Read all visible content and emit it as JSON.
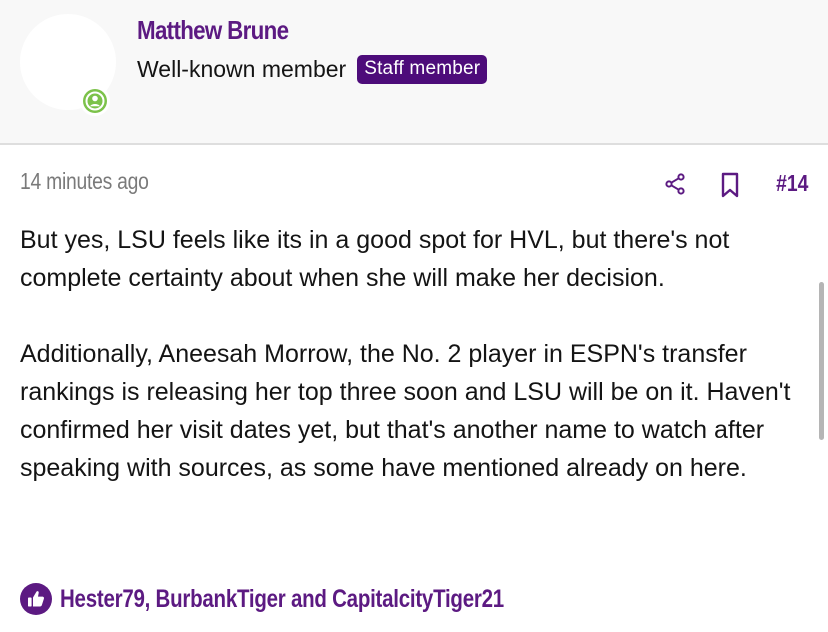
{
  "user": {
    "name": "Matthew Brune",
    "title": "Well-known member",
    "badge": "Staff member",
    "status_icon": "online-user-icon"
  },
  "post": {
    "time": "14 minutes ago",
    "number": "#14",
    "paragraphs": [
      "But yes, LSU feels like its in a good spot for HVL, but there's not complete certainty about when she will make her decision.",
      "Additionally, Aneesah Morrow, the No. 2 player in ESPN's transfer rankings is releasing her top three soon and LSU will be on it. Haven't confirmed her visit dates yet, but that's another name to watch after speaking with sources, as some have mentioned already on here."
    ],
    "actions": {
      "share_icon": "share-icon",
      "bookmark_icon": "bookmark-icon"
    }
  },
  "reactions": {
    "icon": "thumbs-up-icon",
    "users": "Hester79, BurbankTiger and CapitalcityTiger21"
  },
  "colors": {
    "accent": "#5c1a82",
    "badge_bg": "#4d0c7a",
    "online": "#7cc24a",
    "header_bg": "#f8f8f8",
    "meta_text": "#7a7a7a"
  }
}
